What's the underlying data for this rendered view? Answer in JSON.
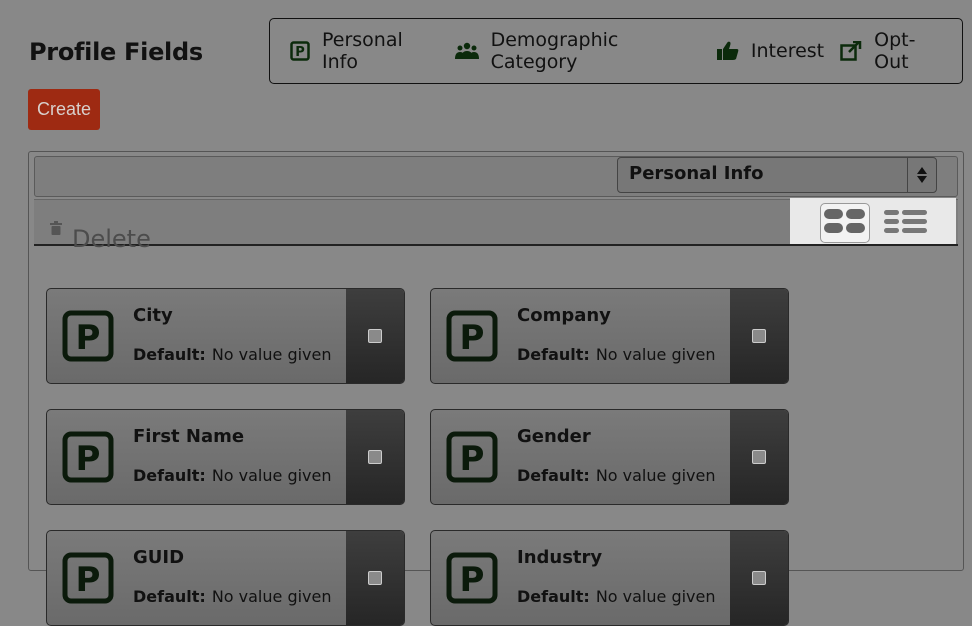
{
  "header": {
    "title": "Profile Fields"
  },
  "legend": [
    {
      "icon": "personal-info-icon",
      "label": "Personal Info"
    },
    {
      "icon": "demographic-category-icon",
      "label": "Demographic Category"
    },
    {
      "icon": "interest-icon",
      "label": "Interest"
    },
    {
      "icon": "opt-out-icon",
      "label": "Opt-Out"
    }
  ],
  "toolbar": {
    "create_label": "Create",
    "delete_label": "Delete"
  },
  "filter": {
    "selected": "Personal Info"
  },
  "colors": {
    "create": "#9e2a12",
    "icon_green": "#0b2a0b",
    "background": "#888888"
  },
  "cards": [
    {
      "name": "City",
      "default_label": "Default:",
      "default_value": "No value given"
    },
    {
      "name": "Company",
      "default_label": "Default:",
      "default_value": "No value given"
    },
    {
      "name": "First Name",
      "default_label": "Default:",
      "default_value": "No value given"
    },
    {
      "name": "Gender",
      "default_label": "Default:",
      "default_value": "No value given"
    },
    {
      "name": "GUID",
      "default_label": "Default:",
      "default_value": "No value given"
    },
    {
      "name": "Industry",
      "default_label": "Default:",
      "default_value": "No value given"
    }
  ]
}
